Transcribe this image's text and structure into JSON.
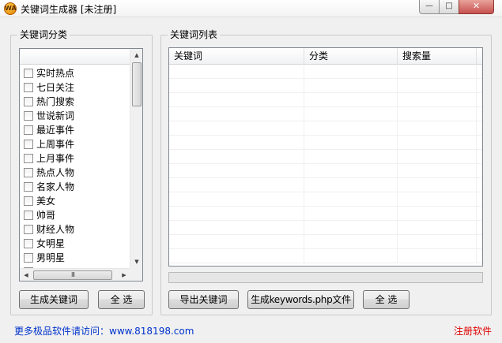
{
  "window": {
    "title": "关键词生成器 [未注册]",
    "icon_text": "WA",
    "minimize_label": "—",
    "maximize_label": "□",
    "close_label": "✕"
  },
  "left_group": {
    "title": "关键词分类",
    "categories": [
      {
        "label": "实时热点",
        "checked": false
      },
      {
        "label": "七日关注",
        "checked": false
      },
      {
        "label": "热门搜索",
        "checked": false
      },
      {
        "label": "世说新词",
        "checked": false
      },
      {
        "label": "最近事件",
        "checked": false
      },
      {
        "label": "上周事件",
        "checked": false
      },
      {
        "label": "上月事件",
        "checked": false
      },
      {
        "label": "热点人物",
        "checked": false
      },
      {
        "label": "名家人物",
        "checked": false
      },
      {
        "label": "美女",
        "checked": false
      },
      {
        "label": "帅哥",
        "checked": false
      },
      {
        "label": "财经人物",
        "checked": false
      },
      {
        "label": "女明星",
        "checked": false
      },
      {
        "label": "男明星",
        "checked": false
      },
      {
        "label": "",
        "checked": false
      }
    ],
    "hscroll_thumb": "III",
    "generate_button": "生成关键词",
    "select_all_button": "全 选"
  },
  "right_group": {
    "title": "关键词列表",
    "columns": [
      "关键词",
      "分类",
      "搜索量"
    ],
    "row_count": 14,
    "progress": 0,
    "export_button": "导出关键词",
    "generate_php_button": "生成keywords.php文件",
    "select_all_button": "全 选"
  },
  "footer": {
    "link_text": "更多极品软件请访问：www.818198.com",
    "register_text": "注册软件"
  },
  "colors": {
    "link": "#0033cc",
    "register": "#e00000",
    "window_bg": "#f0f0f0"
  }
}
